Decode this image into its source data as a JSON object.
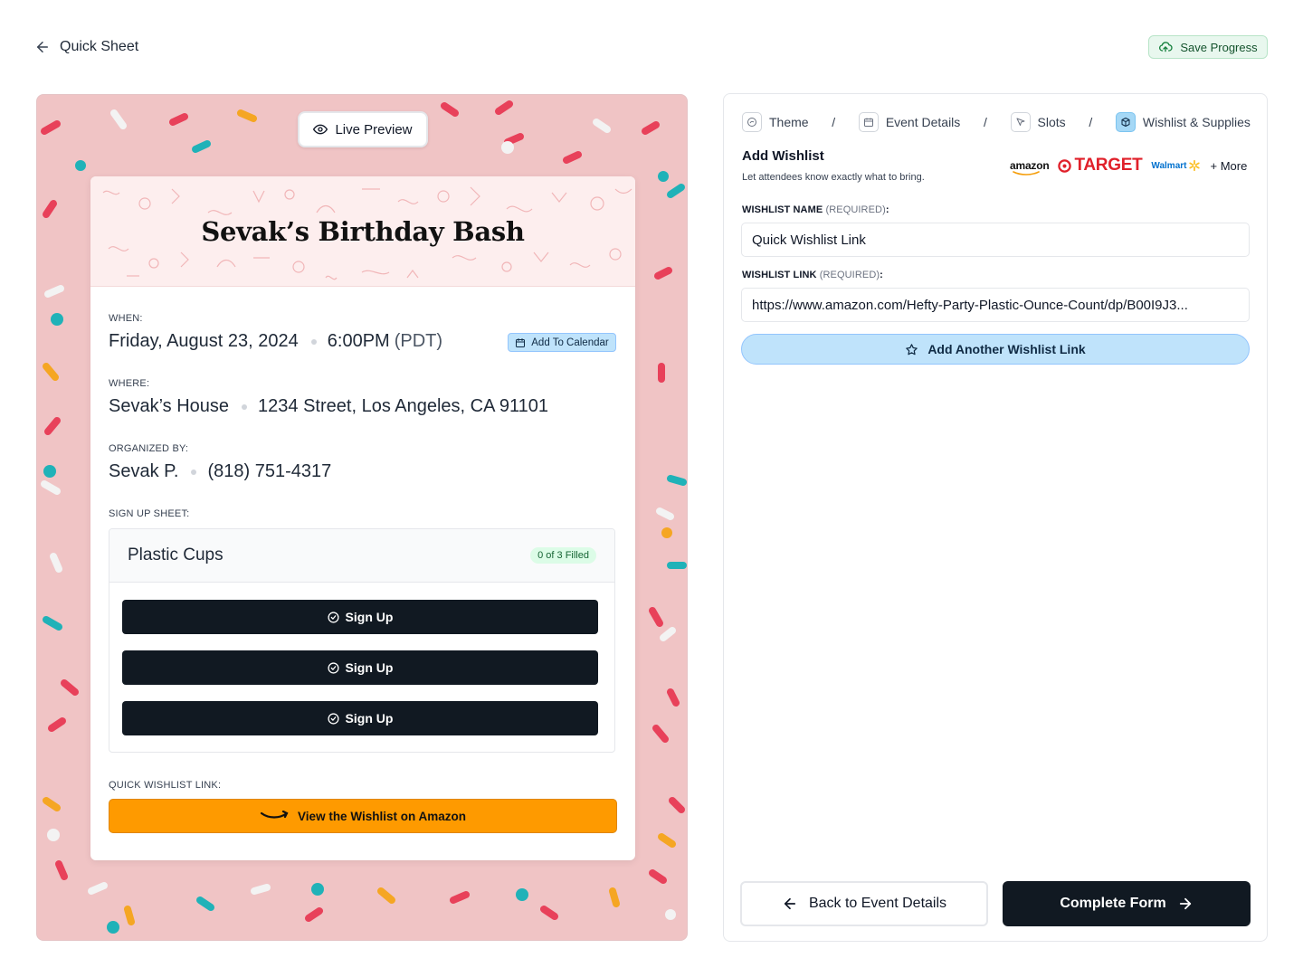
{
  "header": {
    "back_label": "Quick Sheet",
    "save_label": "Save Progress"
  },
  "preview": {
    "live_preview_label": "Live Preview",
    "event_title": "Sevak’s Birthday Bash",
    "when_label": "WHEN:",
    "date": "Friday, August 23, 2024",
    "time": "6:00PM",
    "timezone": "(PDT)",
    "add_to_calendar": "Add To Calendar",
    "where_label": "WHERE:",
    "place_name": "Sevak’s House",
    "address": "1234 Street, Los Angeles, CA 91101",
    "organized_label": "ORGANIZED BY:",
    "organizer": "Sevak P.",
    "phone": "(818) 751-4317",
    "signup_label": "SIGN UP SHEET:",
    "slot": {
      "title": "Plastic Cups",
      "filled": "0 of 3 Filled",
      "buttons": [
        "Sign Up",
        "Sign Up",
        "Sign Up"
      ]
    },
    "wishlist_label": "QUICK WISHLIST LINK:",
    "wishlist_button": "View the Wishlist on Amazon"
  },
  "form": {
    "steps": [
      {
        "label": "Theme",
        "icon": "palette-icon"
      },
      {
        "label": "Event Details",
        "icon": "calendar-icon"
      },
      {
        "label": "Slots",
        "icon": "cursor-icon"
      },
      {
        "label": "Wishlist & Supplies",
        "icon": "box-icon",
        "active": true
      }
    ],
    "step_separator": "/",
    "section_title": "Add Wishlist",
    "section_subtitle": "Let attendees know exactly what to bring.",
    "brands": {
      "amazon": "amazon",
      "target": "TARGET",
      "walmart": "Walmart",
      "more": "+ More"
    },
    "name_label": "WISHLIST NAME",
    "name_required": "(REQUIRED)",
    "name_colon": ":",
    "name_value": "Quick Wishlist Link",
    "link_label": "WISHLIST LINK",
    "link_required": "(REQUIRED)",
    "link_colon": ":",
    "link_value": "https://www.amazon.com/Hefty-Party-Plastic-Ounce-Count/dp/B00I9J3...",
    "add_another": "Add Another Wishlist Link",
    "back_button": "Back to Event Details",
    "complete_button": "Complete Form"
  },
  "colors": {
    "accent_dark": "#111922",
    "accent_blue": "#bfe3fb",
    "amazon_orange": "#fe9a00",
    "preview_bg": "#f0c4c5",
    "success_bg": "#e8f7ee"
  }
}
